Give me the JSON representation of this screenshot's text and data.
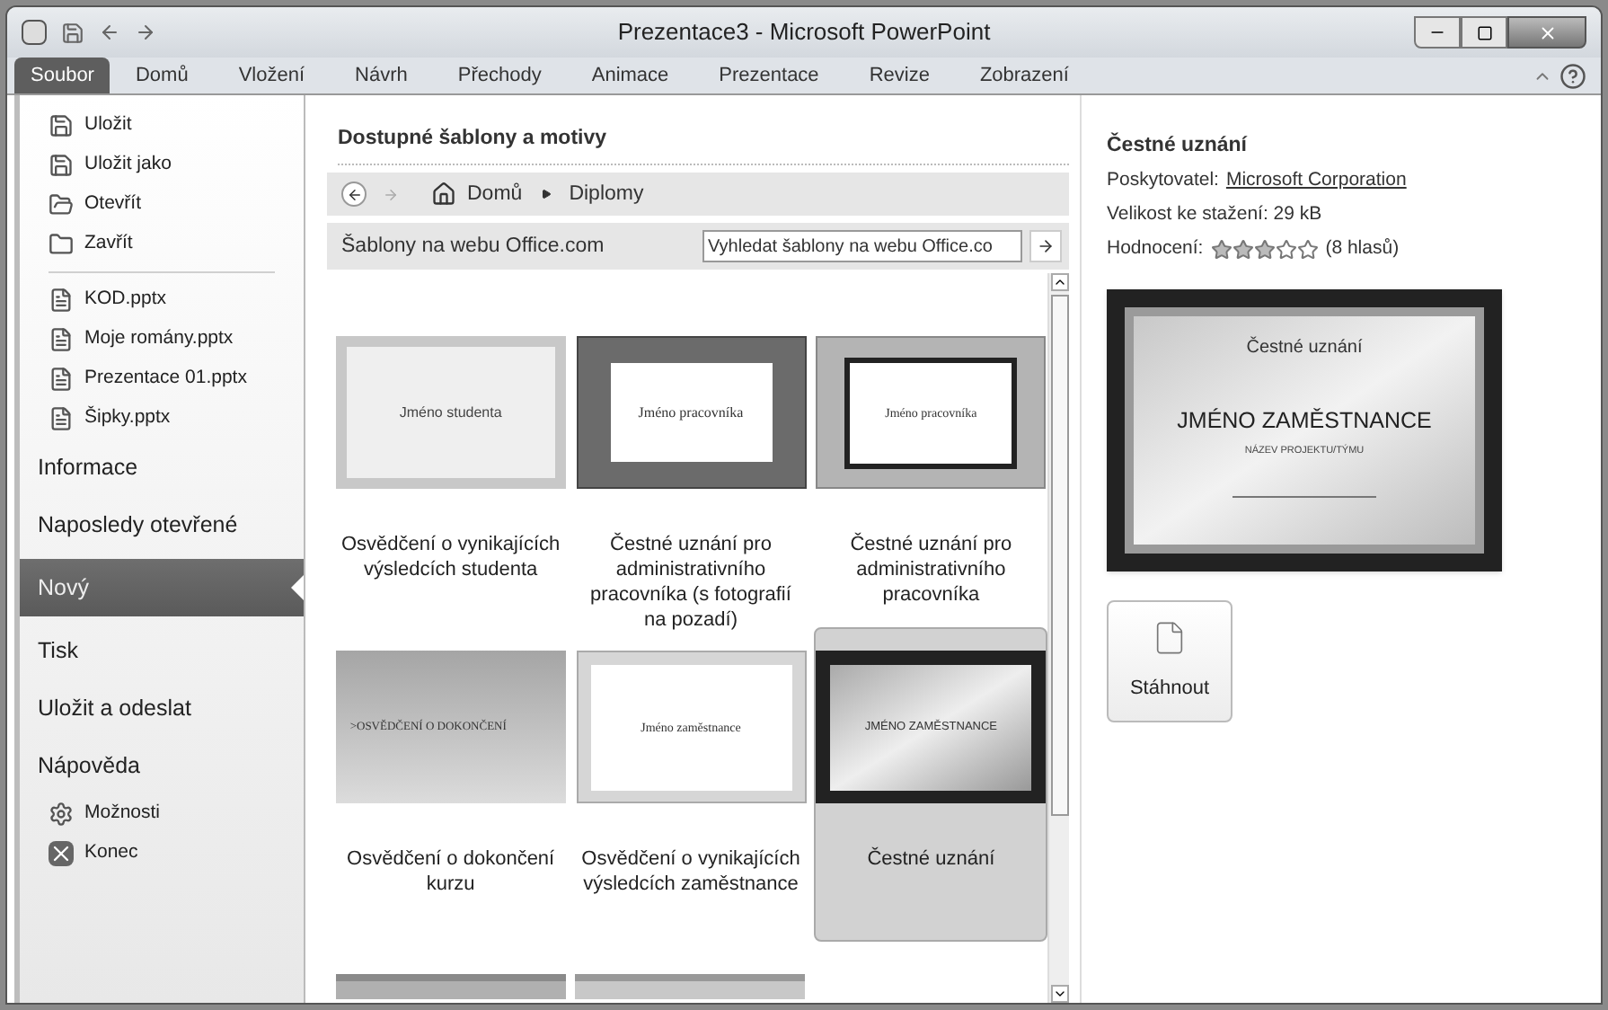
{
  "window": {
    "title": "Prezentace3 - Microsoft PowerPoint"
  },
  "ribbon_tabs": [
    {
      "label": "Soubor",
      "selected": true
    },
    {
      "label": "Domů",
      "selected": false
    },
    {
      "label": "Vložení",
      "selected": false
    },
    {
      "label": "Návrh",
      "selected": false
    },
    {
      "label": "Přechody",
      "selected": false
    },
    {
      "label": "Animace",
      "selected": false
    },
    {
      "label": "Prezentace",
      "selected": false
    },
    {
      "label": "Revize",
      "selected": false
    },
    {
      "label": "Zobrazení",
      "selected": false
    }
  ],
  "sidebar": {
    "items": [
      {
        "kind": "save",
        "label": "Uložit",
        "selected": false
      },
      {
        "kind": "save_as",
        "label": "Uložit jako",
        "selected": false
      },
      {
        "kind": "open",
        "label": "Otevřít",
        "selected": false
      },
      {
        "kind": "close",
        "label": "Zavřít",
        "selected": false
      },
      {
        "kind": "separator"
      },
      {
        "kind": "file",
        "label": "KOD.pptx",
        "selected": false
      },
      {
        "kind": "file",
        "label": "Moje romány.pptx",
        "selected": false
      },
      {
        "kind": "file",
        "label": "Prezentace 01.pptx",
        "selected": false
      },
      {
        "kind": "file",
        "label": "Šipky.pptx",
        "selected": false
      },
      {
        "kind": "page",
        "label": "Informace",
        "selected": false
      },
      {
        "kind": "page",
        "label": "Naposledy otevřené",
        "selected": false
      },
      {
        "kind": "page",
        "label": "Nový",
        "selected": true
      },
      {
        "kind": "page",
        "label": "Tisk",
        "selected": false
      },
      {
        "kind": "page",
        "label": "Uložit a odeslat",
        "selected": false
      },
      {
        "kind": "page",
        "label": "Nápověda",
        "selected": false
      },
      {
        "kind": "options",
        "label": "Možnosti",
        "selected": false
      },
      {
        "kind": "exit",
        "label": "Konec",
        "selected": false
      }
    ]
  },
  "gallery": {
    "title": "Dostupné šablony a motivy",
    "breadcrumb": [
      "Domů",
      "Diplomy"
    ],
    "section_label": "Šablony na webu Office.com",
    "search": {
      "placeholder": "Vyhledat šablony na webu Office.co"
    },
    "templates": [
      {
        "kind": "border",
        "thumb_text": "Jméno studenta",
        "label": "Osvědčení o vynikajících výsledcích studenta",
        "selected": false
      },
      {
        "kind": "flowers",
        "thumb_text": "Jméno pracovníka",
        "label": "Čestné uznání pro administrativního pracovníka (s fotografií na pozadí)",
        "selected": false
      },
      {
        "kind": "frame",
        "thumb_text": "Jméno pracovníka",
        "label": "Čestné uznání pro administrativního pracovníka",
        "selected": false
      },
      {
        "kind": "sky",
        "thumb_text": ">OSVĚDČENÍ O DOKONČENÍ",
        "label": "Osvědčení o dokončení kurzu",
        "selected": false
      },
      {
        "kind": "plain",
        "thumb_text": "Jméno zaměstnance",
        "label": "Osvědčení o vynikajících výsledcích zaměstnance",
        "selected": false
      },
      {
        "kind": "dark",
        "thumb_text": "JMÉNO ZAMĚSTNANCE",
        "label": "Čestné uznání",
        "selected": true
      },
      {
        "kind": "partial_a",
        "selected": false
      },
      {
        "kind": "partial_b",
        "selected": false
      }
    ]
  },
  "details": {
    "title": "Čestné uznání",
    "provider_label": "Poskytovatel:",
    "provider": "Microsoft Corporation",
    "size": "Velikost ke stažení: 29 kB",
    "rating_label": "Hodnocení:",
    "stars": 3,
    "votes": "(8 hlasů)",
    "preview": {
      "heading": "Čestné uznání",
      "name": "JMÉNO ZAMĚSTNANCE",
      "project": "NÁZEV PROJEKTU/TÝMU"
    },
    "download_button": "Stáhnout"
  }
}
